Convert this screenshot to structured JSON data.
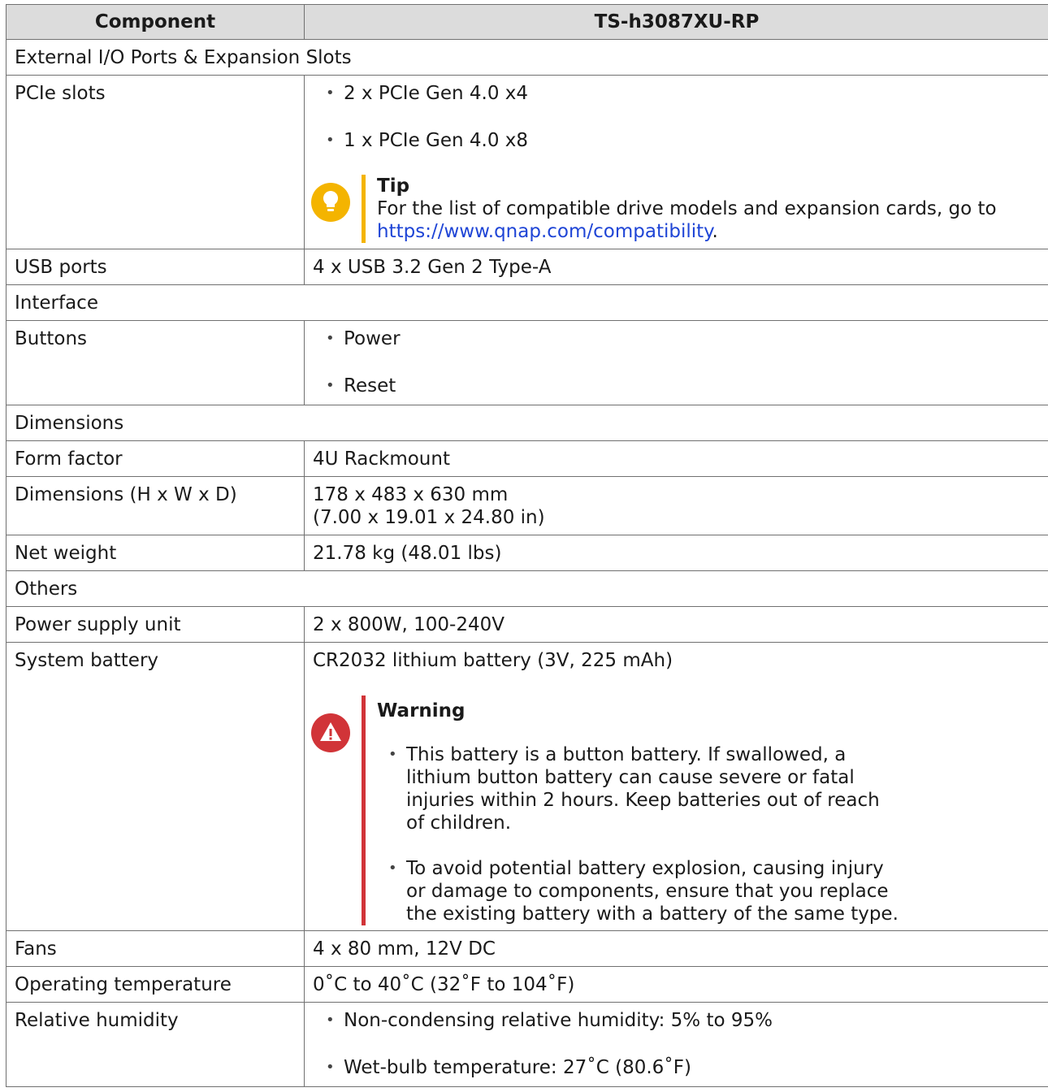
{
  "header": {
    "col1": "Component",
    "col2": "TS-h3087XU-RP"
  },
  "sections": {
    "external": "External I/O Ports & Expansion Slots",
    "interface": "Interface",
    "dimensions": "Dimensions",
    "others": "Others"
  },
  "pcie": {
    "label": "PCIe slots",
    "items": [
      "2 x PCIe Gen 4.0 x4",
      "1 x PCIe Gen 4.0 x8"
    ],
    "tip": {
      "title": "Tip",
      "text": "For the list of compatible drive models and expansion cards, go to ",
      "link": "https://www.qnap.com/compatibility",
      "after": "."
    }
  },
  "usb": {
    "label": "USB ports",
    "value": "4 x USB 3.2 Gen 2 Type-A"
  },
  "buttons": {
    "label": "Buttons",
    "items": [
      "Power",
      "Reset"
    ]
  },
  "form_factor": {
    "label": "Form factor",
    "value": "4U Rackmount"
  },
  "dims": {
    "label": "Dimensions (H x W x D)",
    "line1": "178 x 483 x 630 mm",
    "line2": "(7.00 x 19.01 x 24.80 in)"
  },
  "weight": {
    "label": "Net weight",
    "value": "21.78 kg (48.01 lbs)"
  },
  "psu": {
    "label": "Power supply unit",
    "value": "2 x 800W, 100-240V"
  },
  "battery": {
    "label": "System battery",
    "value": "CR2032 lithium battery (3V, 225 mAh)",
    "warning": {
      "title": "Warning",
      "items": [
        "This battery is a button battery. If swallowed, a lithium button battery can cause severe or fatal injuries within 2 hours. Keep batteries out of reach of children.",
        "To avoid potential battery explosion, causing injury or damage to components, ensure that you replace the existing battery with a battery of the same type."
      ]
    }
  },
  "fans": {
    "label": "Fans",
    "value": "4 x 80 mm, 12V DC"
  },
  "temp": {
    "label": "Operating temperature",
    "value": "0˚C to 40˚C (32˚F to 104˚F)"
  },
  "humidity": {
    "label": "Relative humidity",
    "items": [
      "Non-condensing relative humidity: 5% to 95%",
      "Wet-bulb temperature: 27˚C (80.6˚F)"
    ]
  },
  "colors": {
    "tip": "#f4b400",
    "warning": "#d13438",
    "link": "#1f45d6",
    "header_bg": "#dcdcdc"
  },
  "icons": {
    "tip": "lightbulb-icon",
    "warning": "warning-triangle-icon"
  }
}
